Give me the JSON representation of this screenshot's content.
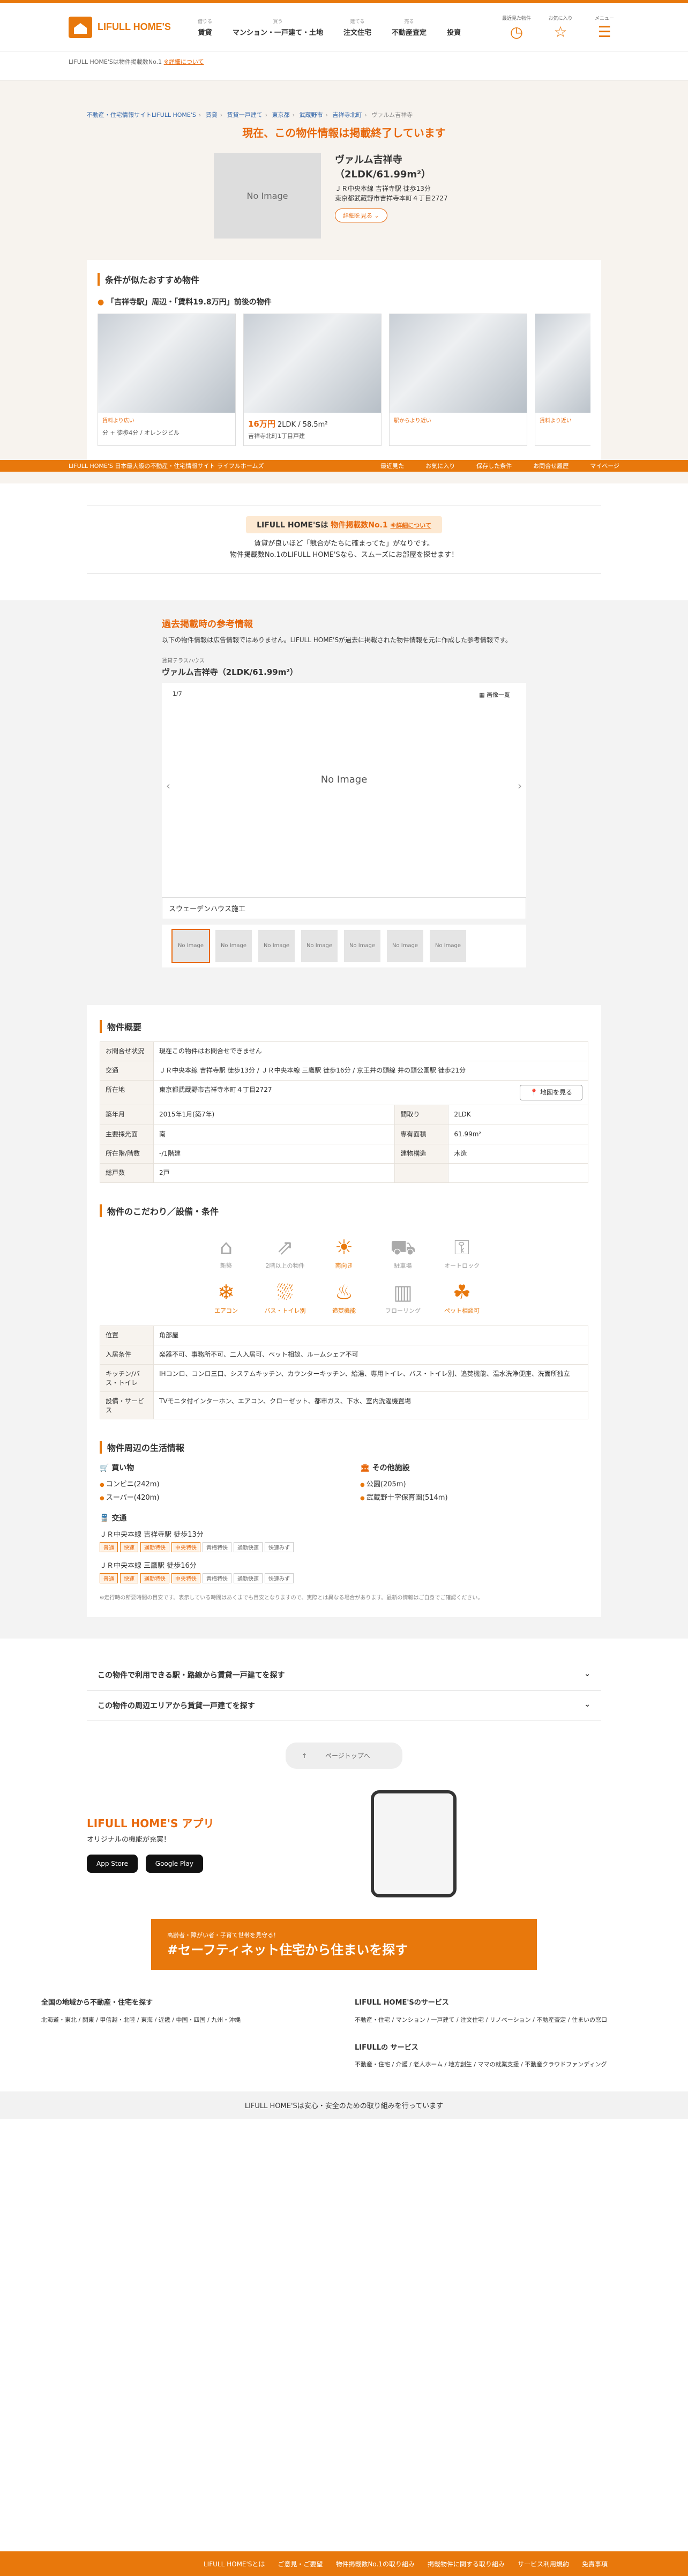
{
  "header": {
    "logo": "LIFULL HOME'S",
    "nav": [
      {
        "small": "借りる",
        "label": "賃貸"
      },
      {
        "small": "買う",
        "label": "マンション・一戸建て・土地"
      },
      {
        "small": "建てる",
        "label": "注文住宅"
      },
      {
        "small": "売る",
        "label": "不動産査定"
      },
      {
        "small": "",
        "label": "投資"
      }
    ],
    "icons": [
      {
        "name": "history-icon",
        "label": "最近見た物件"
      },
      {
        "name": "star-icon",
        "label": "お気に入り"
      },
      {
        "name": "menu-icon",
        "label": "メニュー"
      }
    ]
  },
  "subhead": {
    "text": "LIFULL HOME'Sは物件掲載数No.1",
    "link": "※詳細について"
  },
  "breadcrumb": [
    "不動産・住宅情報サイトLIFULL HOME'S",
    "賃貸",
    "賃貸一戸建て",
    "東京都",
    "武蔵野市",
    "吉祥寺北町",
    "ヴァルム吉祥寺"
  ],
  "ended": {
    "title": "現在、この物件情報は掲載終了しています",
    "noimage": "No Image",
    "name": "ヴァルム吉祥寺（2LDK/61.99m²）",
    "access": "ＪＲ中央本線 吉祥寺駅 徒歩13分",
    "address": "東京都武蔵野市吉祥寺本町４丁目2727",
    "detail_btn": "詳細を見る"
  },
  "recommend": {
    "heading": "条件が似たおすすめ物件",
    "sub": "「吉祥寺駅」周辺・「賃料19.8万円」前後の物件",
    "cards": [
      {
        "tag": "賃料より広い",
        "price": "",
        "layout": "",
        "addr": "分 + 徒歩4分 / オレンジビル"
      },
      {
        "tag": "",
        "price": "16万円",
        "layout": "2LDK / 58.5m²",
        "addr": "吉祥寺北町1丁目戸建"
      },
      {
        "tag": "駅からより近い",
        "price": "",
        "layout": "",
        "addr": ""
      },
      {
        "tag": "賃料より近い",
        "price": "",
        "layout": "",
        "addr": ""
      }
    ]
  },
  "sticky": [
    "LIFULL HOME'S 日本最大級の不動産・住宅情報サイト ライフルホームズ",
    "最近見た",
    "お気に入り",
    "保存した条件",
    "お問合せ履歴",
    "マイページ"
  ],
  "no1": {
    "badge_pre": "LIFULL HOME'Sは",
    "badge_em": "物件掲載数No.1",
    "badge_link": "※詳細について",
    "p1": "賃貸が良いほど「競合がたちに確まってた」がなりです。",
    "p2": "物件掲載数No.1のLIFULL HOME'Sなら、スムーズにお部屋を探せます！"
  },
  "past": {
    "title": "過去掲載時の参考情報",
    "note": "以下の物件情報は広告情報ではありません。LIFULL HOME'Sが過去に掲載された物件情報を元に作成した参考情報です。",
    "type": "賃貸テラスハウス",
    "name": "ヴァルム吉祥寺（2LDK/61.99m²）",
    "count": "1/7",
    "all": "画像一覧",
    "noimage": "No Image",
    "caption": "スウェーデンハウス施工",
    "thumbs": [
      "No Image",
      "No Image",
      "No Image",
      "No Image",
      "No Image",
      "No Image",
      "No Image"
    ]
  },
  "overview": {
    "title": "物件概要",
    "rows": [
      {
        "k": "お問合せ状況",
        "v": "現在この物件はお問合せできません"
      },
      {
        "k": "交通",
        "v": "ＪＲ中央本線 吉祥寺駅 徒歩13分 / ＪＲ中央本線 三鷹駅 徒歩16分 / 京王井の頭線 井の頭公園駅 徒歩21分"
      },
      {
        "k": "所在地",
        "v": "東京都武蔵野市吉祥寺本町４丁目2727",
        "btn": "地図を見る"
      }
    ],
    "grid": [
      [
        "築年月",
        "2015年1月(築7年)",
        "間取り",
        "2LDK"
      ],
      [
        "主要採光面",
        "南",
        "専有面積",
        "61.99m²"
      ],
      [
        "所在階/階数",
        "-/1階建",
        "建物構造",
        "木造"
      ],
      [
        "総戸数",
        "2戸",
        "",
        ""
      ]
    ]
  },
  "features": {
    "title": "物件のこだわり／設備・条件",
    "icons": [
      {
        "label": "新築",
        "on": false,
        "g": "⌂"
      },
      {
        "label": "2階以上の物件",
        "on": false,
        "g": "⇗"
      },
      {
        "label": "南向き",
        "on": true,
        "g": "☀"
      },
      {
        "label": "駐車場",
        "on": false,
        "g": "⛟"
      },
      {
        "label": "オートロック",
        "on": false,
        "g": "⚿"
      },
      {
        "label": "エアコン",
        "on": true,
        "g": "❄"
      },
      {
        "label": "バス・トイレ別",
        "on": true,
        "g": "⛆"
      },
      {
        "label": "追焚機能",
        "on": true,
        "g": "♨"
      },
      {
        "label": "フローリング",
        "on": false,
        "g": "▥"
      },
      {
        "label": "ペット相談可",
        "on": true,
        "g": "☘"
      }
    ],
    "rows": [
      {
        "k": "位置",
        "v": "角部屋"
      },
      {
        "k": "入居条件",
        "v": "楽器不可、事務所不可、二人入居可、ペット相談、ルームシェア不可"
      },
      {
        "k": "キッチン/バス・トイレ",
        "v": "IHコンロ、コンロ三口、システムキッチン、カウンターキッチン、給湯、専用トイレ、バス・トイレ別、追焚機能、温水洗浄便座、洗面所独立"
      },
      {
        "k": "設備・サービス",
        "v": "TVモニタ付インターホン、エアコン、クローゼット、都市ガス、下水、室内洗濯機置場"
      }
    ]
  },
  "life": {
    "title": "物件周辺の生活情報",
    "shop_h": "買い物",
    "shops": [
      "コンビニ(242m)",
      "スーパー(420m)"
    ],
    "other_h": "その他施設",
    "others": [
      "公園(205m)",
      "武蔵野十字保育園(514m)"
    ],
    "traffic_h": "交通",
    "stations": [
      {
        "line": "ＪＲ中央本線 吉祥寺駅 徒歩13分",
        "tags": [
          "普通",
          "快速",
          "通勤特快",
          "中央特快",
          "青梅特快",
          "通勤快速",
          "快速みず"
        ]
      },
      {
        "line": "ＪＲ中央本線 三鷹駅 徒歩16分",
        "tags": [
          "普通",
          "快速",
          "通勤特快",
          "中央特快",
          "青梅特快",
          "通勤快速",
          "快速みず"
        ]
      }
    ],
    "fine": "※走行時の所要時間の目安です。表示している時間はあくまでも目安となりますので、実際とは異なる場合があります。最新の情報はご自身でご確認ください。"
  },
  "acc": [
    "この物件で利用できる駅・路線から賃貸一戸建てを探す",
    "この物件の周辺エリアから賃貸一戸建てを探す"
  ],
  "pagetop": "ページトップへ",
  "footer": {
    "app_title": "LIFULL HOME'S アプリ",
    "app_sub": "オリジナルの機能が充実！",
    "appstore": "App Store",
    "googleplay": "Google Play",
    "safety_small": "高齢者・障がい者・子育て世帯を見守る！",
    "safety": "#セーフティネット住宅から住まいを探す",
    "col1_h": "全国の地域から不動産・住宅を探す",
    "col1": "北海道・東北 / 関東 / 甲信越・北陸 / 東海 / 近畿 / 中国・四国 / 九州・沖縄",
    "col2_h": "LIFULL HOME'Sのサービス",
    "col2": "不動産・住宅 / マンション / 一戸建て / 注文住宅 / リノベーション / 不動産査定 / 住まいの窓口",
    "col3_h": "LIFULLの サービス",
    "col3": "不動産・住宅 / 介護 / 老人ホーム / 地方創生 / ママの就業支援 / 不動産クラウドファンディング",
    "bar": "LIFULL HOME'Sは安心・安全のための取り組みを行っています",
    "bottom": [
      "LIFULL HOME'Sとは",
      "ご意見・ご要望",
      "物件掲載数No.1の取り組み",
      "掲載物件に関する取り組み",
      "サービス利用規約",
      "免責事項"
    ]
  }
}
